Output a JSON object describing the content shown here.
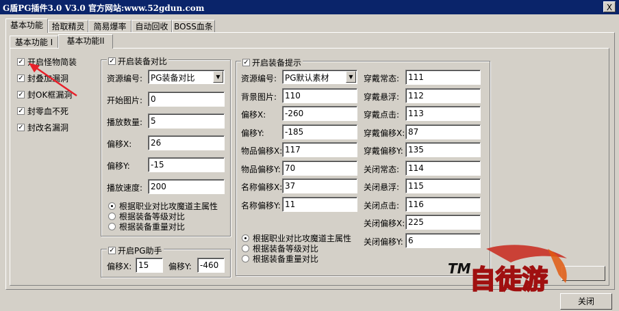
{
  "window": {
    "title": "G盾PG插件3.0 V3.0  官方网站:www.52gdun.com",
    "close_glyph": "X"
  },
  "tabs": [
    "基本功能",
    "拾取精灵",
    "简易爆率",
    "自动回收",
    "BOSS血条"
  ],
  "subtabs": [
    "基本功能 I",
    "基本功能II"
  ],
  "left_checks": [
    "开启怪物简装",
    "封叠加漏洞",
    "封OK框漏洞",
    "封零血不死",
    "封改名漏洞"
  ],
  "equip_compare": {
    "title": "开启装备对比",
    "fields": [
      {
        "label": "资源编号:",
        "value": "PG装备对比",
        "type": "select"
      },
      {
        "label": "开始图片:",
        "value": "0"
      },
      {
        "label": "播放数量:",
        "value": "5"
      },
      {
        "label": "偏移X:",
        "value": "26"
      },
      {
        "label": "偏移Y:",
        "value": "-15"
      },
      {
        "label": "播放速度:",
        "value": "200"
      }
    ],
    "radios": [
      "根据职业对比攻魔道主属性",
      "根据装备等级对比",
      "根据装备重量对比"
    ],
    "selected_radio": 0
  },
  "pg_helper": {
    "title": "开启PG助手",
    "offset_x_label": "偏移X:",
    "offset_x": "15",
    "offset_y_label": "偏移Y:",
    "offset_y": "-460"
  },
  "equip_tip": {
    "title": "开启装备提示",
    "left_fields": [
      {
        "label": "资源编号:",
        "value": "PG默认素材",
        "type": "select"
      },
      {
        "label": "背景图片:",
        "value": "110"
      },
      {
        "label": "偏移X:",
        "value": "-260"
      },
      {
        "label": "偏移Y:",
        "value": "-185"
      },
      {
        "label": "物品偏移X:",
        "value": "117"
      },
      {
        "label": "物品偏移Y:",
        "value": "70"
      },
      {
        "label": "名称偏移X:",
        "value": "37"
      },
      {
        "label": "名称偏移Y:",
        "value": "11"
      }
    ],
    "right_fields": [
      {
        "label": "穿戴常态:",
        "value": "111"
      },
      {
        "label": "穿戴悬浮:",
        "value": "112"
      },
      {
        "label": "穿戴点击:",
        "value": "113"
      },
      {
        "label": "穿戴偏移X:",
        "value": "87"
      },
      {
        "label": "穿戴偏移Y:",
        "value": "135"
      },
      {
        "label": "关闭常态:",
        "value": "114"
      },
      {
        "label": "关闭悬浮:",
        "value": "115"
      },
      {
        "label": "关闭点击:",
        "value": "116"
      },
      {
        "label": "关闭偏移X:",
        "value": "225"
      },
      {
        "label": "关闭偏移Y:",
        "value": "6"
      }
    ],
    "radios": [
      "根据职业对比攻魔道主属性",
      "根据装备等级对比",
      "根据装备重量对比"
    ],
    "selected_radio": 0
  },
  "footer": {
    "close_button": "关闭"
  },
  "watermark": {
    "text": "TM 自徒游"
  },
  "colors": {
    "titlebar": "#0a246a",
    "face": "#d4d0c8",
    "arrow": "#e8202a"
  }
}
